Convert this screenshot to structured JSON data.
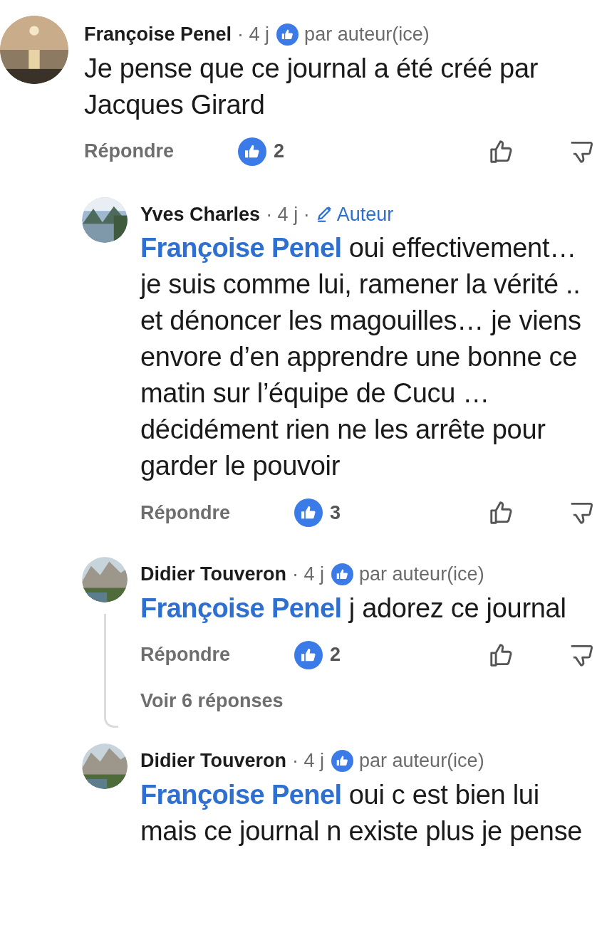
{
  "comments": [
    {
      "author": "Françoise Penel",
      "time": "· 4 j",
      "badge": {
        "kind": "liked",
        "label": "par auteur(ice)"
      },
      "text": "Je pense que ce journal a été créé par Jacques Girard",
      "reply_label": "Répondre",
      "likes": "2",
      "children": [
        {
          "author": "Yves Charles",
          "time": "· 4 j ·",
          "badge": {
            "kind": "author",
            "label": "Auteur"
          },
          "mention": "Françoise Penel",
          "text": "oui effectivement… je suis comme lui, ramener la vérité .. et dénoncer les magouilles… je viens envore d’en apprendre une bonne ce matin sur l’équipe de Cucu … décidément rien ne les arrête pour garder le pouvoir",
          "reply_label": "Répondre",
          "likes": "3"
        },
        {
          "author": "Didier Touveron",
          "time": "· 4 j",
          "badge": {
            "kind": "liked",
            "label": "par auteur(ice)"
          },
          "mention": "Françoise Penel",
          "text": "j adorez ce journal",
          "reply_label": "Répondre",
          "likes": "2",
          "replies_label": "Voir 6 réponses"
        },
        {
          "author": "Didier Touveron",
          "time": "· 4 j",
          "badge": {
            "kind": "liked",
            "label": "par auteur(ice)"
          },
          "mention": "Françoise Penel",
          "text": "oui c est bien lui mais ce journal n existe plus je pense"
        }
      ]
    }
  ]
}
